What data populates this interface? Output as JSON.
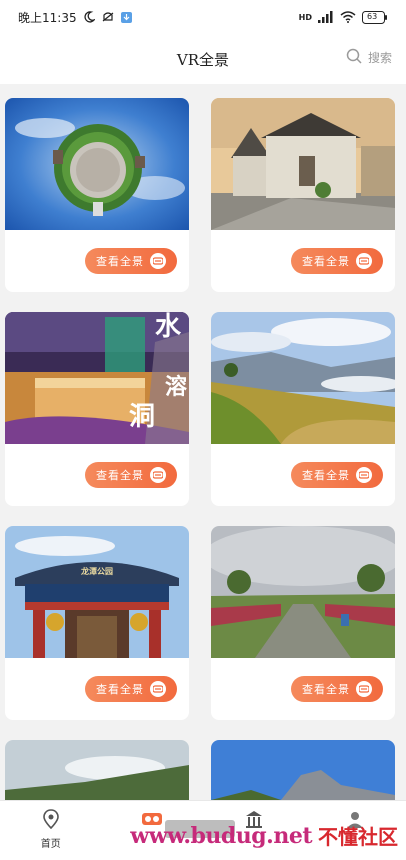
{
  "status_bar": {
    "time": "晚上11:35",
    "network": "HD",
    "battery": "63"
  },
  "header": {
    "title": "VR全景",
    "search_label": "搜索"
  },
  "cards": [
    {
      "button_label": "查看全景",
      "thumb_icon": "tiny-planet-photo"
    },
    {
      "button_label": "查看全景",
      "thumb_icon": "old-town-street-photo"
    },
    {
      "button_label": "查看全景",
      "thumb_icon": "cave-waterfall-photo",
      "overlay_text": [
        "水",
        "溶",
        "洞"
      ]
    },
    {
      "button_label": "查看全景",
      "thumb_icon": "terraced-hills-photo"
    },
    {
      "button_label": "查看全景",
      "thumb_icon": "park-gate-photo",
      "sign_text": "龙潭公园"
    },
    {
      "button_label": "查看全景",
      "thumb_icon": "garden-path-photo"
    },
    {
      "thumb_icon": "mountain-sky-photo"
    },
    {
      "thumb_icon": "rock-peak-photo"
    }
  ],
  "bottom_nav": {
    "items": [
      {
        "label": "首页",
        "icon": "location-pin-icon"
      },
      {
        "label": "",
        "icon": "vr-headset-icon"
      },
      {
        "label": "",
        "icon": "building-icon"
      },
      {
        "label": "",
        "icon": "user-icon"
      }
    ]
  },
  "watermark": {
    "url": "www.budug.net",
    "text": "不懂社区"
  },
  "colors": {
    "accent": "#f26a3e",
    "accent_light": "#f58a5c",
    "background": "#f2f2f2",
    "card": "#ffffff"
  }
}
